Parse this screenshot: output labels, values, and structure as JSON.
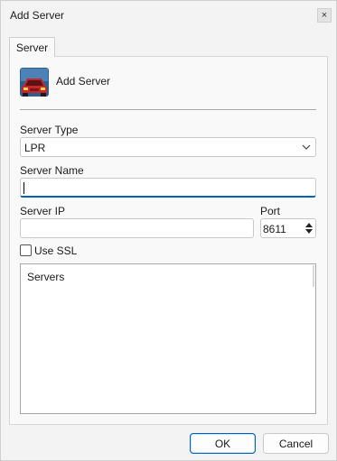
{
  "window": {
    "title": "Add Server",
    "close_symbol": "×"
  },
  "tabs": [
    {
      "label": "Server",
      "active": true
    }
  ],
  "header": {
    "title": "Add Server",
    "icon": "red-car-icon"
  },
  "form": {
    "server_type": {
      "label": "Server Type",
      "value": "LPR"
    },
    "server_name": {
      "label": "Server Name",
      "value": ""
    },
    "server_ip": {
      "label": "Server IP",
      "value": ""
    },
    "port": {
      "label": "Port",
      "value": "8611"
    },
    "use_ssl": {
      "label": "Use SSL",
      "checked": false
    }
  },
  "servers_list": {
    "header": "Servers",
    "items": []
  },
  "buttons": {
    "ok": "OK",
    "cancel": "Cancel"
  },
  "colors": {
    "accent": "#005fb8",
    "car": "#c8262b",
    "icon_bg": "#2f5f8f"
  }
}
